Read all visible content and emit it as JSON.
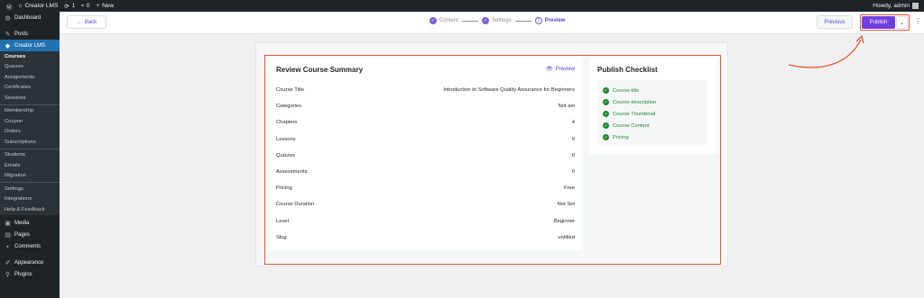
{
  "admin_bar": {
    "site_name": "Creator LMS",
    "updates_count": "1",
    "comments_count": "0",
    "new_label": "New",
    "greeting": "Howdy, admin",
    "icons": [
      "wordpress-icon",
      "home-icon",
      "updates-icon",
      "comment-icon",
      "plus-icon"
    ]
  },
  "sidebar": {
    "dashboard": "Dashboard",
    "posts": "Posts",
    "creator_lms": "Creator LMS",
    "group1": [
      "Courses",
      "Quizzes",
      "Assignments",
      "Certificates",
      "Sessions"
    ],
    "group2": [
      "Membership",
      "Coupon",
      "Orders",
      "Subscriptions"
    ],
    "group3": [
      "Students",
      "Emails",
      "Migration"
    ],
    "group4": [
      "Settings",
      "Integrations",
      "Help & Feedback"
    ],
    "media": "Media",
    "pages": "Pages",
    "comments": "Comments",
    "appearance": "Appearance",
    "plugins": "Plugins"
  },
  "header": {
    "back_label": "Back",
    "steps": [
      {
        "label": "Content",
        "state": "done"
      },
      {
        "label": "Settings",
        "state": "done"
      },
      {
        "label": "Preview",
        "state": "current",
        "number": "3"
      }
    ],
    "previous_label": "Previous",
    "publish_label": "Publish"
  },
  "summary": {
    "title": "Review Course Summary",
    "preview_label": "Preview",
    "rows": [
      {
        "label": "Course Title",
        "value": "Introduction to Software Quality Assurance for Beginners"
      },
      {
        "label": "Categories",
        "value": "Not set"
      },
      {
        "label": "Chapters",
        "value": "4"
      },
      {
        "label": "Lessons",
        "value": "9"
      },
      {
        "label": "Quizzes",
        "value": "0"
      },
      {
        "label": "Assessments",
        "value": "0"
      },
      {
        "label": "Pricing",
        "value": "Free"
      },
      {
        "label": "Course Duration",
        "value": "Not Set"
      },
      {
        "label": "Level",
        "value": "Beginner"
      },
      {
        "label": "Slug",
        "value": "untitled"
      }
    ]
  },
  "checklist": {
    "title": "Publish Checklist",
    "items": [
      "Course title",
      "Course description",
      "Course Thumbnail",
      "Course Content",
      "Pricing"
    ]
  },
  "colors": {
    "accent": "#6f3fe0",
    "highlight": "#e8542f",
    "success": "#1a8a2a",
    "admin_dark": "#1d2327",
    "menu_active": "#2271b1"
  }
}
